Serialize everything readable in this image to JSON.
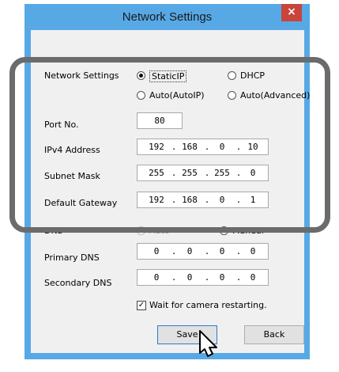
{
  "window": {
    "title": "Network Settings",
    "close_glyph": "×"
  },
  "network_settings": {
    "label": "Network Settings",
    "options": [
      {
        "label": "StaticIP",
        "selected": true
      },
      {
        "label": "DHCP",
        "selected": false
      },
      {
        "label": "Auto(AutoIP)",
        "selected": false
      },
      {
        "label": "Auto(Advanced)",
        "selected": false
      }
    ]
  },
  "port": {
    "label": "Port No.",
    "value": "80"
  },
  "ipv4": {
    "label": "IPv4 Address",
    "octets": [
      "192",
      "168",
      "0",
      "10"
    ]
  },
  "subnet": {
    "label": "Subnet Mask",
    "octets": [
      "255",
      "255",
      "255",
      "0"
    ]
  },
  "gateway": {
    "label": "Default Gateway",
    "octets": [
      "192",
      "168",
      "0",
      "1"
    ]
  },
  "dns": {
    "label": "DNS",
    "options": [
      {
        "label": "Auto",
        "selected": false,
        "enabled": false
      },
      {
        "label": "Manual",
        "selected": true,
        "enabled": true
      }
    ]
  },
  "primary_dns": {
    "label": "Primary DNS",
    "octets": [
      "0",
      "0",
      "0",
      "0"
    ]
  },
  "secondary_dns": {
    "label": "Secondary DNS",
    "octets": [
      "0",
      "0",
      "0",
      "0"
    ]
  },
  "wait_restart": {
    "label": "Wait for camera restarting.",
    "checked": true,
    "mark": "✓"
  },
  "buttons": {
    "save": "Save",
    "back": "Back"
  },
  "colors": {
    "frame": "#57a9e6",
    "close": "#c9443b",
    "highlight": "#6b6b6b"
  }
}
